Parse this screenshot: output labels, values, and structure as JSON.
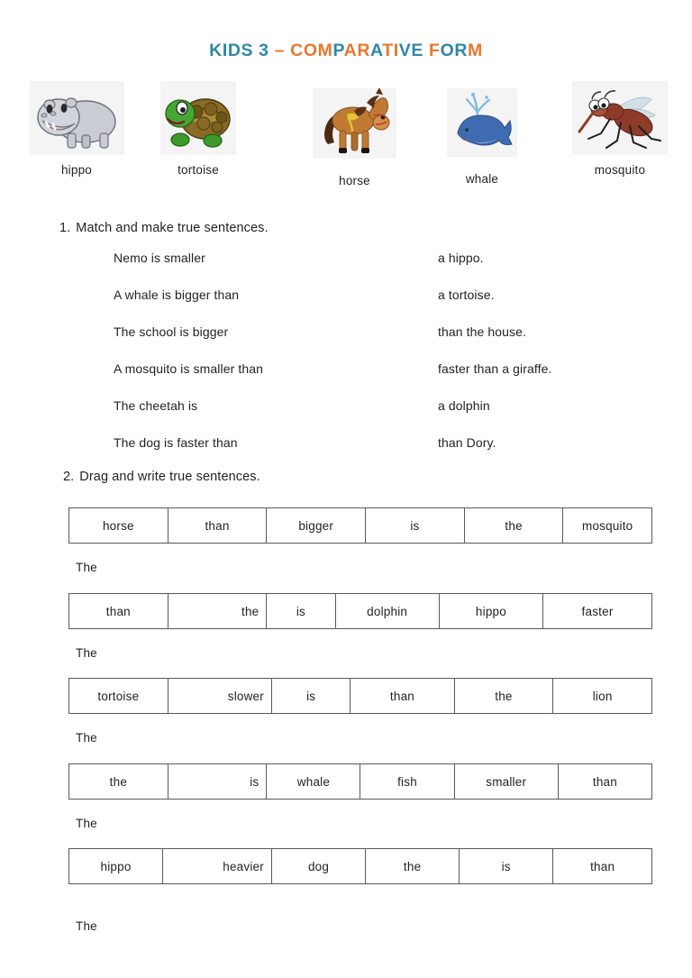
{
  "title": {
    "text": "KIDS 3 – COMPARATIVE FORM",
    "teal": "#2e87a8",
    "orange": "#e8772e",
    "letter_colors": [
      "teal",
      "teal",
      "teal",
      "teal",
      "teal",
      "orange",
      "orange",
      "orange",
      "orange",
      "teal",
      "orange",
      "orange",
      "teal",
      "orange",
      "orange",
      "teal",
      "teal",
      "orange",
      "teal",
      "teal",
      "orange",
      "teal",
      "orange",
      "teal",
      "orange",
      "orange",
      "orange"
    ]
  },
  "animals": [
    {
      "label": "hippo",
      "icon": "hippo-image"
    },
    {
      "label": "tortoise",
      "icon": "tortoise-image"
    },
    {
      "label": "horse",
      "icon": "horse-image"
    },
    {
      "label": "whale",
      "icon": "whale-image"
    },
    {
      "label": "mosquito",
      "icon": "mosquito-image"
    }
  ],
  "exercise1": {
    "number": "1.",
    "instruction": "Match and make true sentences.",
    "left": [
      "Nemo is smaller",
      "A whale is bigger than",
      "The school is bigger",
      "A mosquito is smaller than",
      "The cheetah is",
      "The dog is faster than"
    ],
    "right": [
      "a hippo.",
      "a tortoise.",
      "than the house.",
      "faster than a giraffe.",
      "a dolphin",
      "than Dory."
    ]
  },
  "exercise2": {
    "number": "2.",
    "instruction": "Drag and write true sentences.",
    "answer_prefix": "The",
    "tables": [
      {
        "cells": [
          "horse",
          "than",
          "bigger",
          "is",
          "the",
          "mosquito"
        ],
        "widths": [
          17,
          17,
          17,
          17,
          17,
          15
        ],
        "aligns": [
          "center",
          "center",
          "center",
          "center",
          "center",
          "center"
        ]
      },
      {
        "cells": [
          "than",
          "the",
          "is",
          "dolphin",
          "hippo",
          "faster"
        ],
        "widths": [
          17,
          17,
          11,
          18,
          18,
          19
        ],
        "aligns": [
          "center",
          "right",
          "center",
          "center",
          "center",
          "center"
        ]
      },
      {
        "cells": [
          "tortoise",
          "slower",
          "is",
          "than",
          "the",
          "lion"
        ],
        "widths": [
          17,
          18,
          13,
          18,
          17,
          17
        ],
        "aligns": [
          "center",
          "right",
          "center",
          "center",
          "center",
          "center"
        ]
      },
      {
        "cells": [
          "the",
          "is",
          "whale",
          "fish",
          "smaller",
          "than"
        ],
        "widths": [
          17,
          17,
          16,
          16,
          18,
          16
        ],
        "aligns": [
          "center",
          "right",
          "center",
          "center",
          "center",
          "center"
        ]
      },
      {
        "cells": [
          "hippo",
          "heavier",
          "dog",
          "the",
          "is",
          "than"
        ],
        "widths": [
          16,
          19,
          16,
          16,
          16,
          17
        ],
        "aligns": [
          "center",
          "right",
          "center",
          "center",
          "center",
          "center"
        ]
      }
    ]
  }
}
